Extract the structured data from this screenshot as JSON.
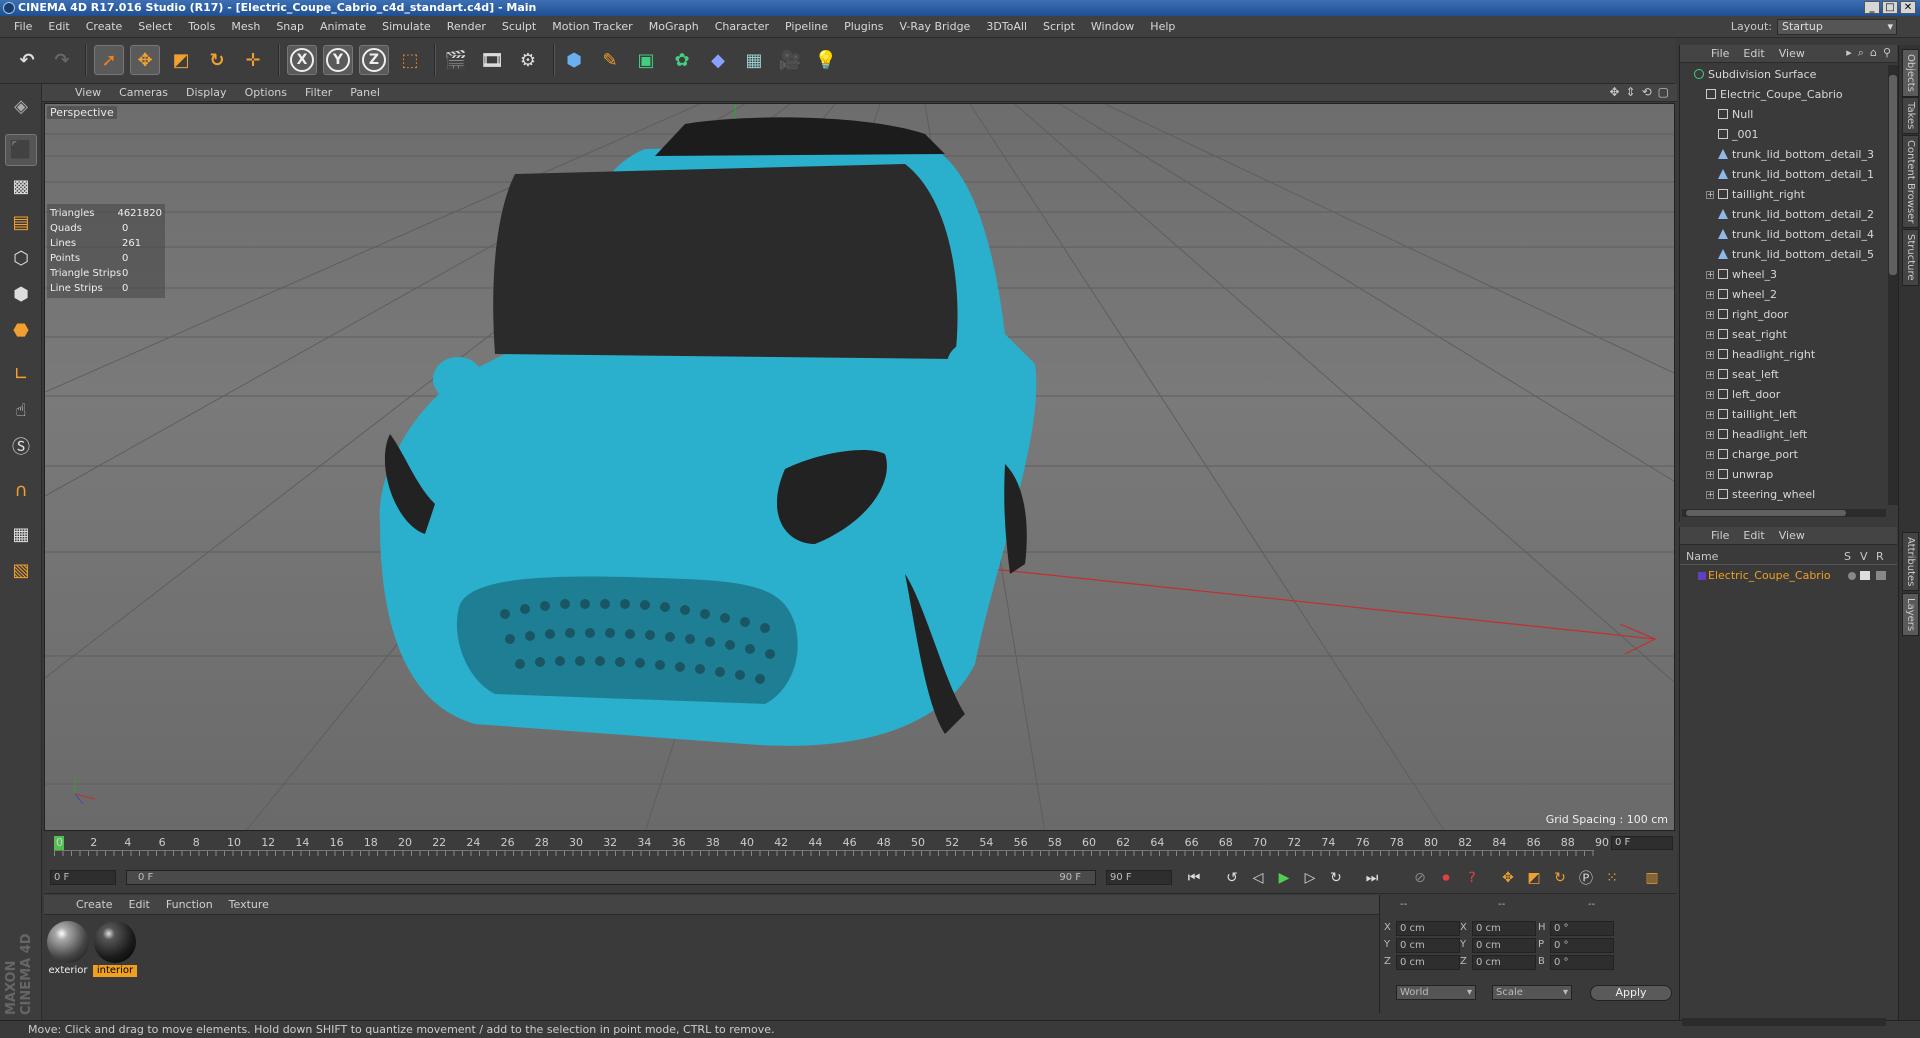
{
  "window": {
    "title": "CINEMA 4D R17.016 Studio (R17) - [Electric_Coupe_Cabrio_c4d_standart.c4d] - Main"
  },
  "menu": [
    "File",
    "Edit",
    "Create",
    "Select",
    "Tools",
    "Mesh",
    "Snap",
    "Animate",
    "Simulate",
    "Render",
    "Sculpt",
    "Motion Tracker",
    "MoGraph",
    "Character",
    "Pipeline",
    "Plugins",
    "V-Ray Bridge",
    "3DToAll",
    "Script",
    "Window",
    "Help"
  ],
  "layout": {
    "label": "Layout:",
    "value": "Startup"
  },
  "toolbar": {
    "x": "X",
    "y": "Y",
    "z": "Z"
  },
  "viewport": {
    "menu": [
      "View",
      "Cameras",
      "Display",
      "Options",
      "Filter",
      "Panel"
    ],
    "label": "Perspective",
    "grid_spacing": "Grid Spacing : 100 cm",
    "stats": [
      {
        "k": "Triangles",
        "v": "4621820"
      },
      {
        "k": "Quads",
        "v": "0"
      },
      {
        "k": "Lines",
        "v": "261"
      },
      {
        "k": "Points",
        "v": "0"
      },
      {
        "k": "Triangle Strips",
        "v": "0"
      },
      {
        "k": "Line Strips",
        "v": "0"
      }
    ],
    "colors": {
      "car_body": "#2ab0cc",
      "grid_bg": "#707070"
    }
  },
  "timeline": {
    "ticks": [
      "0",
      "2",
      "4",
      "6",
      "8",
      "10",
      "12",
      "14",
      "16",
      "18",
      "20",
      "22",
      "24",
      "26",
      "28",
      "30",
      "32",
      "34",
      "36",
      "38",
      "40",
      "42",
      "44",
      "46",
      "48",
      "50",
      "52",
      "54",
      "56",
      "58",
      "60",
      "62",
      "64",
      "66",
      "68",
      "70",
      "72",
      "74",
      "76",
      "78",
      "80",
      "82",
      "84",
      "86",
      "88",
      "90"
    ],
    "current_frame": "0 F",
    "start": "0 F",
    "range_start": "0 F",
    "range_end": "90 F",
    "end": "90 F"
  },
  "materials": {
    "menu": [
      "Create",
      "Edit",
      "Function",
      "Texture"
    ],
    "items": [
      {
        "name": "exterior",
        "selected": false
      },
      {
        "name": "interior",
        "selected": true
      }
    ]
  },
  "coords": {
    "header": [
      "--",
      "--",
      "--"
    ],
    "rows": [
      {
        "a": "X",
        "av": "0 cm",
        "b": "X",
        "bv": "0 cm",
        "c": "H",
        "cv": "0 °"
      },
      {
        "a": "Y",
        "av": "0 cm",
        "b": "Y",
        "bv": "0 cm",
        "c": "P",
        "cv": "0 °"
      },
      {
        "a": "Z",
        "av": "0 cm",
        "b": "Z",
        "bv": "0 cm",
        "c": "B",
        "cv": "0 °"
      }
    ],
    "world": "World",
    "scale": "Scale",
    "apply": "Apply"
  },
  "status": "Move: Click and drag to move elements. Hold down SHIFT to quantize movement / add to the selection in point mode, CTRL to remove.",
  "branding": "MAXON CINEMA 4D",
  "objects": {
    "menu": [
      "File",
      "Edit",
      "View"
    ],
    "items": [
      {
        "name": "Subdivision Surface",
        "indent": 0,
        "type": "sub"
      },
      {
        "name": "Electric_Coupe_Cabrio",
        "indent": 1,
        "type": "null"
      },
      {
        "name": "Null",
        "indent": 2,
        "type": "null"
      },
      {
        "name": "_001",
        "indent": 2,
        "type": "null"
      },
      {
        "name": "trunk_lid_bottom_detail_3",
        "indent": 2,
        "type": "poly"
      },
      {
        "name": "trunk_lid_bottom_detail_1",
        "indent": 2,
        "type": "poly"
      },
      {
        "name": "taillight_right",
        "indent": 2,
        "type": "null",
        "plus": true
      },
      {
        "name": "trunk_lid_bottom_detail_2",
        "indent": 2,
        "type": "poly"
      },
      {
        "name": "trunk_lid_bottom_detail_4",
        "indent": 2,
        "type": "poly"
      },
      {
        "name": "trunk_lid_bottom_detail_5",
        "indent": 2,
        "type": "poly"
      },
      {
        "name": "wheel_3",
        "indent": 2,
        "type": "null",
        "plus": true
      },
      {
        "name": "wheel_2",
        "indent": 2,
        "type": "null",
        "plus": true
      },
      {
        "name": "right_door",
        "indent": 2,
        "type": "null",
        "plus": true
      },
      {
        "name": "seat_right",
        "indent": 2,
        "type": "null",
        "plus": true
      },
      {
        "name": "headlight_right",
        "indent": 2,
        "type": "null",
        "plus": true
      },
      {
        "name": "seat_left",
        "indent": 2,
        "type": "null",
        "plus": true
      },
      {
        "name": "left_door",
        "indent": 2,
        "type": "null",
        "plus": true
      },
      {
        "name": "taillight_left",
        "indent": 2,
        "type": "null",
        "plus": true
      },
      {
        "name": "headlight_left",
        "indent": 2,
        "type": "null",
        "plus": true
      },
      {
        "name": "charge_port",
        "indent": 2,
        "type": "null",
        "plus": true
      },
      {
        "name": "unwrap",
        "indent": 2,
        "type": "null",
        "plus": true
      },
      {
        "name": "steering_wheel",
        "indent": 2,
        "type": "null",
        "plus": true
      }
    ]
  },
  "layers": {
    "menu": [
      "File",
      "Edit",
      "View"
    ],
    "header": {
      "name": "Name",
      "s": "S",
      "v": "V",
      "r": "R"
    },
    "items": [
      {
        "name": "Electric_Coupe_Cabrio"
      }
    ]
  },
  "side_tabs": [
    "Objects",
    "Takes",
    "Content Browser",
    "Structure",
    "Attributes",
    "Layers"
  ]
}
